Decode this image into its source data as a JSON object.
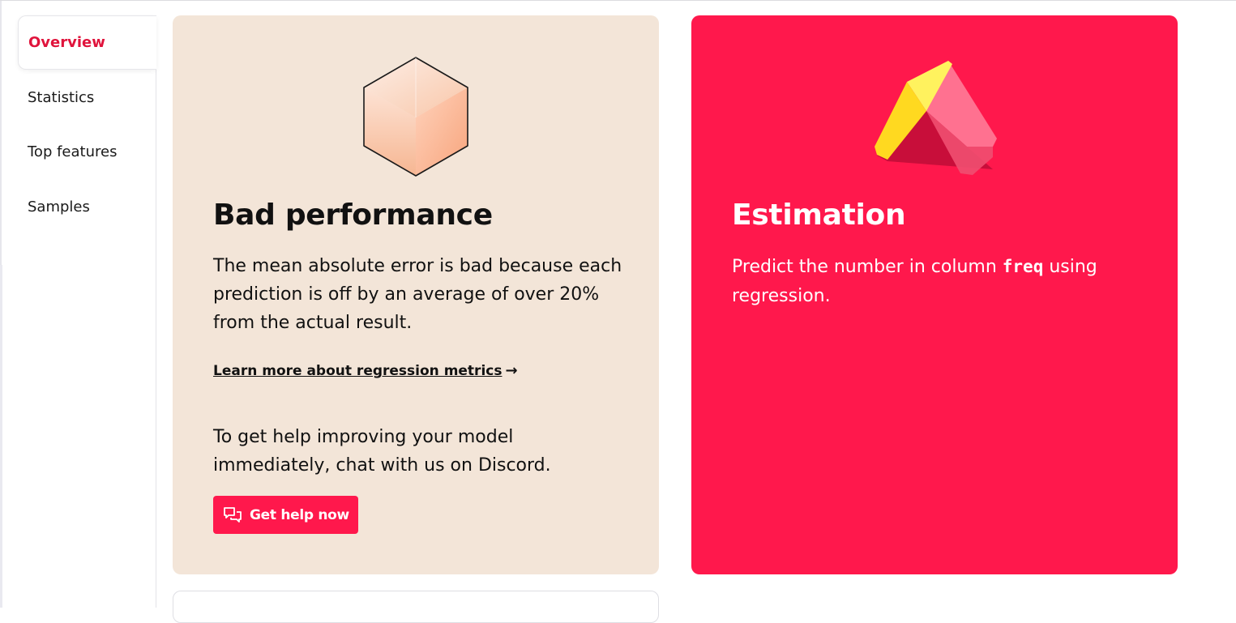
{
  "sidebar": {
    "items": [
      {
        "label": "Overview",
        "active": true
      },
      {
        "label": "Statistics",
        "active": false
      },
      {
        "label": "Top features",
        "active": false
      },
      {
        "label": "Samples",
        "active": false
      }
    ]
  },
  "performance_card": {
    "icon": "cube-icon",
    "title": "Bad performance",
    "description": "The mean absolute error is bad because each prediction is off by an average of over 20% from the actual result.",
    "learn_more_link": "Learn more about regression metrics",
    "help_text": "To get help improving your model immediately, chat with us on Discord.",
    "help_button": "Get help now",
    "help_button_icon": "chat-bubbles-icon",
    "background_color": "#f3e5d8"
  },
  "estimation_card": {
    "icon": "pyramid-icon",
    "title": "Estimation",
    "description_before": "Predict the number in column",
    "column_name": "freq",
    "description_after": "using regression.",
    "background_color": "#ff184c"
  },
  "colors": {
    "accent": "#ff184c",
    "active_nav": "#e0143c"
  }
}
